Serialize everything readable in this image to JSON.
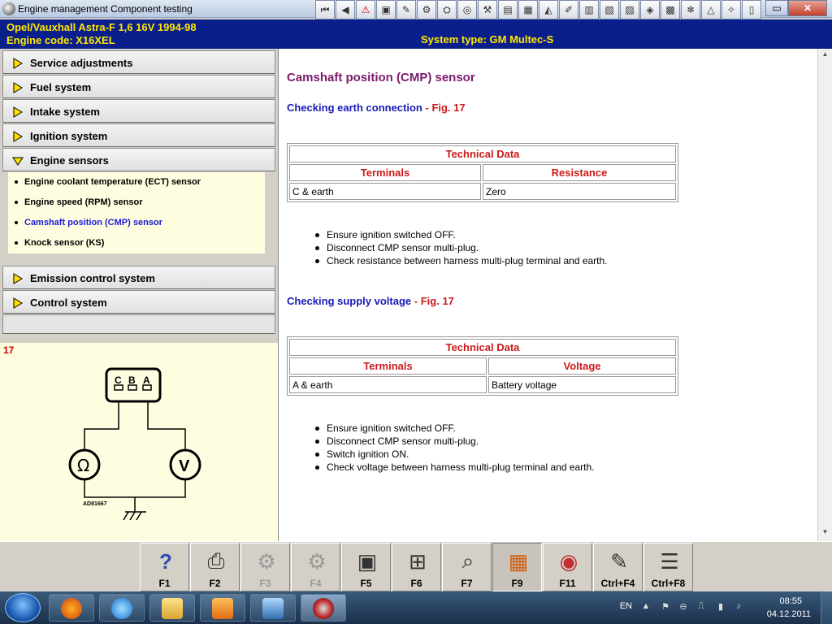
{
  "window": {
    "title": "Engine management Component testing"
  },
  "header": {
    "vehicle": "Opel/Vauxhall   Astra-F  1,6 16V 1994-98",
    "engine_code": "Engine code: X16XEL",
    "system_type": "System type: GM Multec-S"
  },
  "menu": {
    "items": [
      {
        "label": "Service adjustments"
      },
      {
        "label": "Fuel system"
      },
      {
        "label": "Intake system"
      },
      {
        "label": "Ignition system"
      },
      {
        "label": "Engine sensors"
      },
      {
        "label": "Emission control system"
      },
      {
        "label": "Control system"
      }
    ],
    "sub_items": [
      {
        "label": "Engine coolant temperature (ECT) sensor"
      },
      {
        "label": "Engine speed (RPM) sensor"
      },
      {
        "label": "Camshaft position (CMP) sensor"
      },
      {
        "label": "Knock sensor (KS)"
      }
    ]
  },
  "diagram": {
    "fig_number": "17",
    "pin_labels": [
      "C",
      "B",
      "A"
    ],
    "code": "AD81667"
  },
  "content": {
    "title": "Camshaft position (CMP) sensor",
    "section1": {
      "heading": "Checking earth connection",
      "fig": "- Fig. 17",
      "table": {
        "caption": "Technical Data",
        "col1": "Terminals",
        "col2": "Resistance",
        "row": [
          "C & earth",
          "Zero"
        ]
      },
      "steps": [
        "Ensure ignition switched OFF.",
        "Disconnect CMP sensor multi-plug.",
        "Check resistance between harness multi-plug terminal and earth."
      ]
    },
    "section2": {
      "heading": "Checking supply voltage",
      "fig": "- Fig. 17",
      "table": {
        "caption": "Technical Data",
        "col1": "Terminals",
        "col2": "Voltage",
        "row": [
          "A & earth",
          "Battery voltage"
        ]
      },
      "steps": [
        "Ensure ignition switched OFF.",
        "Disconnect CMP sensor multi-plug.",
        "Switch ignition ON.",
        "Check voltage between harness multi-plug terminal and earth."
      ]
    }
  },
  "fkeys": [
    {
      "label": "F1",
      "icon": "help-icon"
    },
    {
      "label": "F2",
      "icon": "printer-icon"
    },
    {
      "label": "F3",
      "icon": "disabled-tool-icon"
    },
    {
      "label": "F4",
      "icon": "disabled-tool-icon"
    },
    {
      "label": "F5",
      "icon": "component-icon"
    },
    {
      "label": "F6",
      "icon": "connector-icon"
    },
    {
      "label": "F7",
      "icon": "magnifier-icon"
    },
    {
      "label": "F9",
      "icon": "grid-icon"
    },
    {
      "label": "F11",
      "icon": "gauge-magnifier-icon"
    },
    {
      "label": "Ctrl+F4",
      "icon": "notes-icon"
    },
    {
      "label": "Ctrl+F8",
      "icon": "list-icon"
    }
  ],
  "taskbar": {
    "lang": "EN",
    "time": "08:55",
    "date": "04.12.2011"
  }
}
